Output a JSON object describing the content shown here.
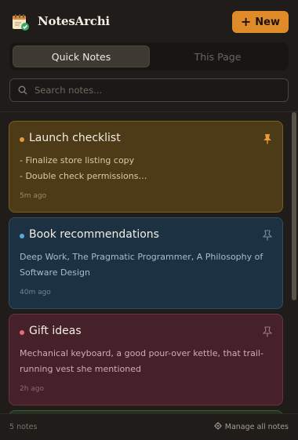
{
  "app": {
    "title": "NotesArchi"
  },
  "header": {
    "new_label": "New"
  },
  "tabs": [
    {
      "label": "Quick Notes",
      "active": true
    },
    {
      "label": "This Page",
      "active": false
    }
  ],
  "search": {
    "placeholder": "Search notes...",
    "value": ""
  },
  "notes": [
    {
      "title": "Launch checklist",
      "lines": [
        "- Finalize store listing copy",
        "- Double check permissions…"
      ],
      "time": "5m ago",
      "color": "#e89a3a",
      "pinned": true
    },
    {
      "title": "Book recommendations",
      "lines": [
        "Deep Work, The Pragmatic Programmer, A Philosophy of",
        "Software Design"
      ],
      "time": "40m ago",
      "color": "#5aa8d6",
      "pinned": false
    },
    {
      "title": "Gift ideas",
      "lines": [
        "Mechanical keyboard, a good pour-over kettle, that trail-",
        "running vest she mentioned"
      ],
      "time": "2h ago",
      "color": "#e56b7f",
      "pinned": false
    }
  ],
  "footer": {
    "count": "5 notes",
    "manage_label": "Manage all notes"
  },
  "icons": {
    "logo": "notepad-check-icon",
    "new": "plus-icon",
    "search": "search-icon",
    "pin": "pin-icon",
    "manage": "gear-icon"
  }
}
